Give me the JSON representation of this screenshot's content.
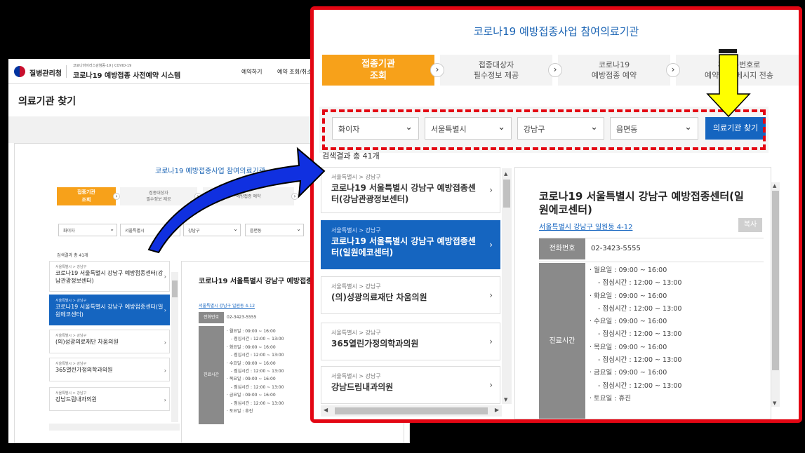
{
  "background_screenshot": {
    "header": {
      "org_name": "질병관리청",
      "subtitle": "코로나바이러스감염증-19 | COVID-19",
      "title": "코로나19 예방접종 사전예약 시스템",
      "nav": [
        "예약하기",
        "예약 조회/취소"
      ]
    },
    "page_title": "의료기관 찾기",
    "panel_title": "코로나19 예방접종사업 참여의료기관",
    "steps": [
      {
        "label": "접종기관\n조회"
      },
      {
        "label": "접종대상자\n필수정보 제공"
      },
      {
        "label": "예방접종 예약"
      }
    ],
    "filters": [
      "화이자",
      "서울특별시",
      "강남구",
      "읍면동"
    ],
    "result_count": "검색결과 총 41개",
    "list": [
      {
        "region": "서울특별시 > 강남구",
        "name": "코로나19 서울특별시 강남구 예방접종센터(강남관광정보센터)"
      },
      {
        "region": "서울특별시 > 강남구",
        "name": "코로나19 서울특별시 강남구 예방접종센터(일원에코센터)"
      },
      {
        "region": "서울특별시 > 강남구",
        "name": "(의)성광의료재단 차움의원"
      },
      {
        "region": "서울특별시 > 강남구",
        "name": "365열린가정의학과의원"
      },
      {
        "region": "서울특별시 > 강남구",
        "name": "강남드림내과의원"
      }
    ],
    "detail": {
      "name": "코로나19 서울특별시 강남구 예방접종센터(일원에코센터)",
      "address": "서울특별시 강남구 일원동 4-12",
      "phone_label": "전화번호",
      "phone": "02-3423-5555",
      "hours_label": "진료시간",
      "hours": [
        "· 월요일 : 09:00 ~ 16:00",
        "- 점심시간 : 12:00 ~ 13:00",
        "· 화요일 : 09:00 ~ 16:00",
        "- 점심시간 : 12:00 ~ 13:00",
        "· 수요일 : 09:00 ~ 16:00",
        "- 점심시간 : 12:00 ~ 13:00",
        "· 목요일 : 09:00 ~ 16:00",
        "- 점심시간 : 12:00 ~ 13:00",
        "· 금요일 : 09:00 ~ 16:00",
        "- 점심시간 : 12:00 ~ 13:00",
        "· 토요일 : 휴진"
      ]
    }
  },
  "zoomed": {
    "panel_title": "코로나19 예방접종사업 참여의료기관",
    "steps": [
      {
        "line1": "접종기관",
        "line2": "조회",
        "active": true
      },
      {
        "line1": "접종대상자",
        "line2": "필수정보 제공",
        "active": false
      },
      {
        "line1": "코로나19",
        "line2": "예방접종 예약",
        "active": false
      },
      {
        "line1": "휴대폰번호로",
        "line2": "예약정보 메시지 전송",
        "active": false
      }
    ],
    "filters": {
      "vaccine": "화이자",
      "city": "서울특별시",
      "district": "강남구",
      "town": "읍면동"
    },
    "find_button": "의료기관 찾기",
    "result_count": "검색결과 총 41개",
    "list": [
      {
        "region": "서울특별시 > 강남구",
        "name": "코로나19 서울특별시 강남구 예방접종센터(강남관광정보센터)",
        "selected": false
      },
      {
        "region": "서울특별시 > 강남구",
        "name": "코로나19 서울특별시 강남구 예방접종센터(일원에코센터)",
        "selected": true
      },
      {
        "region": "서울특별시 > 강남구",
        "name": "(의)성광의료재단 차움의원",
        "selected": false
      },
      {
        "region": "서울특별시 > 강남구",
        "name": "365열린가정의학과의원",
        "selected": false
      },
      {
        "region": "서울특별시 > 강남구",
        "name": "강남드림내과의원",
        "selected": false
      }
    ],
    "detail": {
      "name": "코로나19 서울특별시 강남구 예방접종센터(일원에코센터)",
      "address": "서울특별시 강남구 일원동 4-12",
      "copy_button": "복사",
      "phone_label": "전화번호",
      "phone": "02-3423-5555",
      "hours_label": "진료시간",
      "hours": [
        {
          "text": "· 월요일 : 09:00 ~ 16:00",
          "sub": false
        },
        {
          "text": "- 점심시간 : 12:00 ~ 13:00",
          "sub": true
        },
        {
          "text": "· 화요일 : 09:00 ~ 16:00",
          "sub": false
        },
        {
          "text": "- 점심시간 : 12:00 ~ 13:00",
          "sub": true
        },
        {
          "text": "· 수요일 : 09:00 ~ 16:00",
          "sub": false
        },
        {
          "text": "- 점심시간 : 12:00 ~ 13:00",
          "sub": true
        },
        {
          "text": "· 목요일 : 09:00 ~ 16:00",
          "sub": false
        },
        {
          "text": "- 점심시간 : 12:00 ~ 13:00",
          "sub": true
        },
        {
          "text": "· 금요일 : 09:00 ~ 16:00",
          "sub": false
        },
        {
          "text": "- 점심시간 : 12:00 ~ 13:00",
          "sub": true
        },
        {
          "text": "· 토요일 : 휴진",
          "sub": false
        }
      ]
    }
  },
  "colors": {
    "accent_orange": "#f7a11a",
    "primary_blue": "#1565c0",
    "highlight_red": "#e30613",
    "arrow_blue": "#1030e0",
    "arrow_yellow": "#ffff00"
  },
  "icons": {
    "chevron_right": "›",
    "chevron_down": "⌄"
  }
}
